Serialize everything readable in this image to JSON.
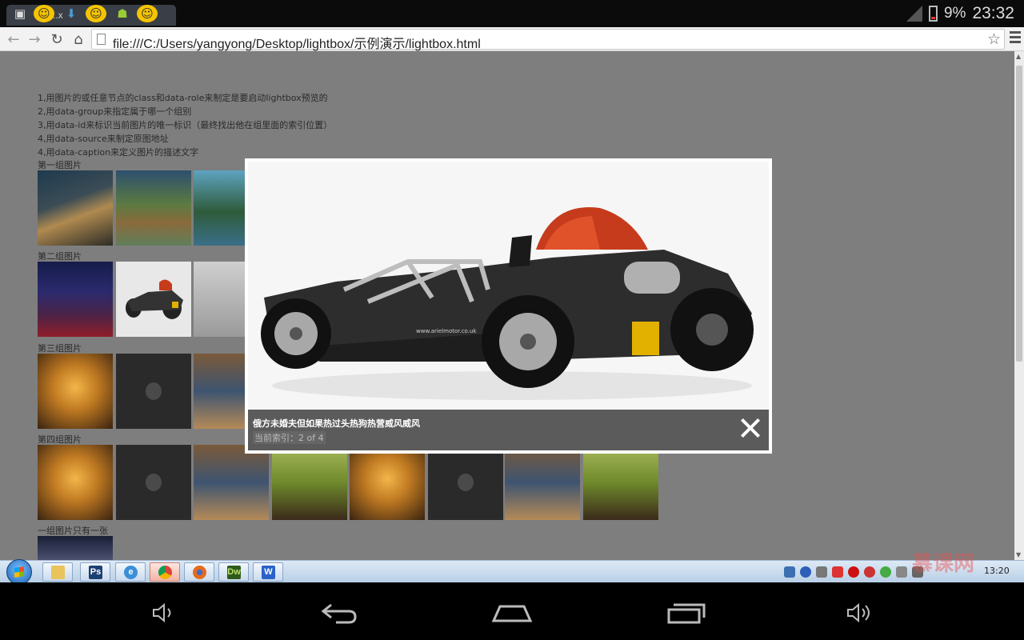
{
  "status_bar": {
    "tab_label": "light..x",
    "battery": "9%",
    "time": "23:32"
  },
  "browser": {
    "url": "file:///C:/Users/yangyong/Desktop/lightbox/示例演示/lightbox.html",
    "back_icon": "back-arrow-icon",
    "forward_icon": "forward-arrow-icon",
    "reload_icon": "reload-icon",
    "home_icon": "home-icon",
    "bookmark_icon": "star-icon"
  },
  "page": {
    "notes": [
      "1,用图片的或任意节点的class和data-role来制定是要启动lightbox预览的",
      "2,用data-group来指定属于哪一个组别",
      "3,用data-id来标识当前图片的唯一标识（最终找出他在组里面的索引位置）",
      "4,用data-source来制定原图地址",
      "4,用data-caption来定义图片的描述文字"
    ],
    "groups": [
      {
        "title": "第一组图片"
      },
      {
        "title": "第二组图片"
      },
      {
        "title": "第三组图片"
      },
      {
        "title": "第四组图片"
      },
      {
        "title": "一组图片只有一张"
      }
    ]
  },
  "lightbox": {
    "caption": "俄方未婚夫但如果热过头热狗热营威风威风",
    "index": "当前索引：2 of 4",
    "image_alt": "ariel-atom-car",
    "car_url_text": "www.arielmotor.co.uk"
  },
  "taskbar": {
    "clock": "13:20",
    "apps": [
      "explorer",
      "photoshop",
      "ie",
      "chrome",
      "firefox",
      "dreamweaver",
      "wps"
    ]
  },
  "watermark": "慕课网"
}
